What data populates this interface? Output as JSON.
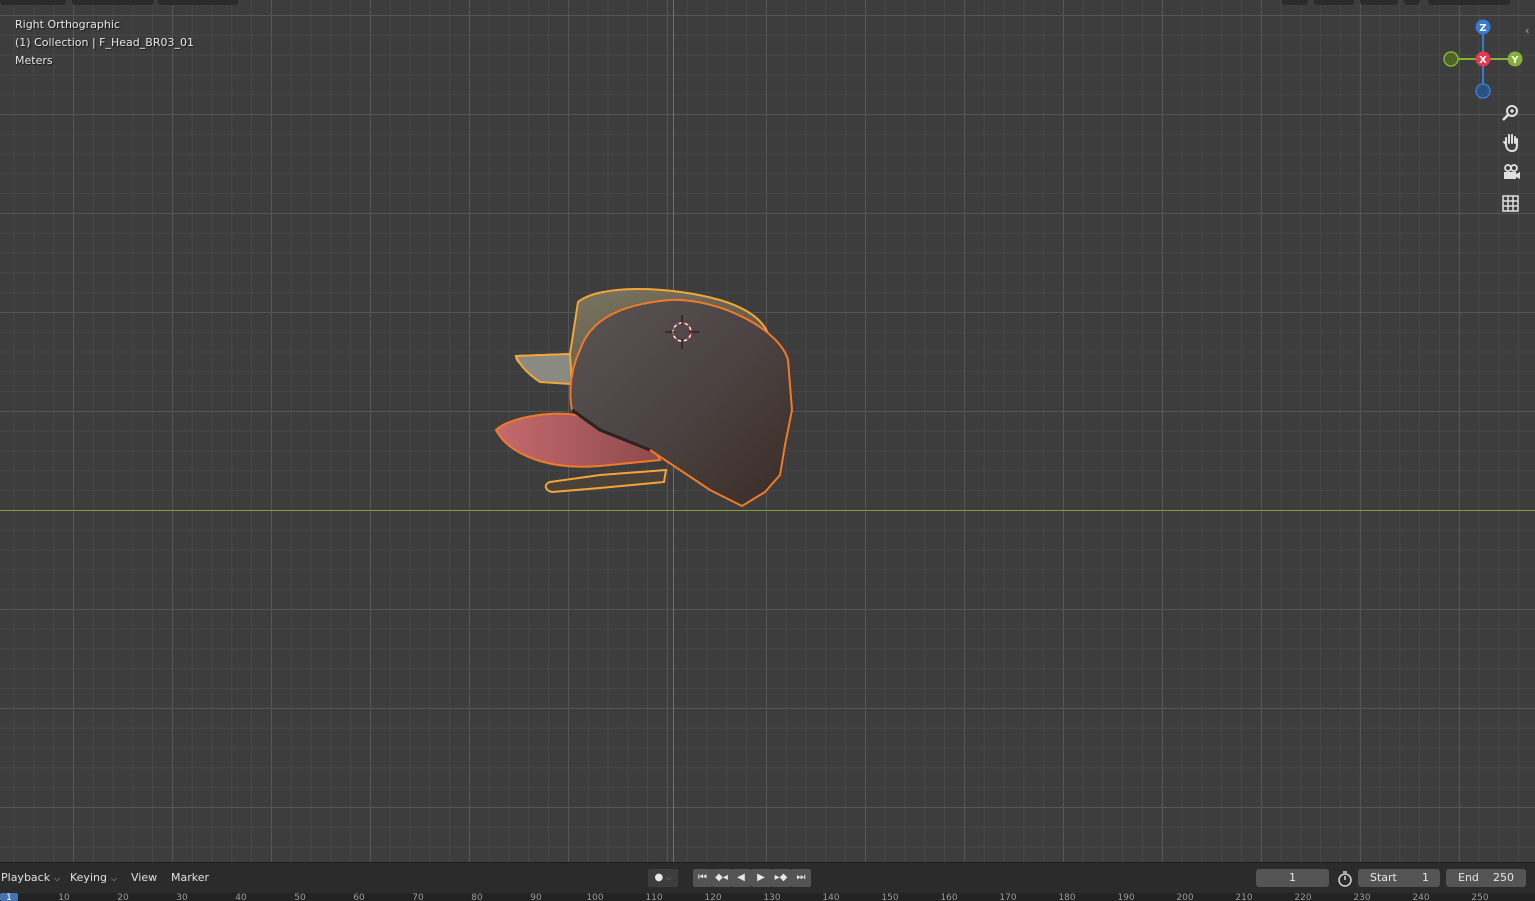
{
  "viewport": {
    "view_name": "Right Orthographic",
    "collection_info": "(1) Collection | F_Head_BR03_01",
    "units": "Meters"
  },
  "gizmo": {
    "z_label": "Z",
    "x_label": "X",
    "y_label": "Y"
  },
  "nav_tools": [
    "zoom-icon",
    "hand-pan-icon",
    "camera-icon",
    "grid-icon"
  ],
  "timeline": {
    "menus": {
      "playback": "Playback",
      "keying": "Keying",
      "view": "View",
      "marker": "Marker"
    },
    "current_frame": "1",
    "start_label": "Start",
    "start_value": "1",
    "end_label": "End",
    "end_value": "250",
    "ruler_ticks": [
      "1",
      "10",
      "20",
      "30",
      "40",
      "50",
      "60",
      "70",
      "80",
      "90",
      "100",
      "110",
      "120",
      "130",
      "140",
      "150",
      "160",
      "170",
      "180",
      "190",
      "200",
      "210",
      "220",
      "230",
      "240",
      "250"
    ]
  },
  "colors": {
    "axis_z": "#3b7bcb",
    "axis_y": "#7f9d3a",
    "selection_outline": "#f07a28",
    "active_frame": "#4772b3"
  }
}
